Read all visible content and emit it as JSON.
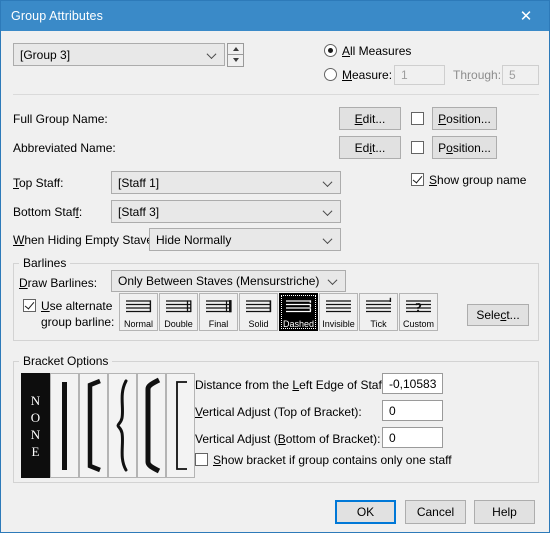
{
  "window": {
    "title": "Group Attributes",
    "close_icon": "close-icon",
    "titlebar_color": "#3a8ac8"
  },
  "top": {
    "group_selector_value": "[Group 3]",
    "spinner_up": "spin-up-icon",
    "spinner_down": "spin-down-icon",
    "all_measures_label": "All Measures",
    "all_measures_selected": true,
    "measure_label": "Measure:",
    "measure_value": "1",
    "through_label": "Through:",
    "through_value": "5"
  },
  "names": {
    "full_group_name_label": "Full Group Name:",
    "abbreviated_name_label": "Abbreviated Name:",
    "edit_label": "Edit...",
    "position_label": "Position...",
    "show_group_name_label": "Show group name",
    "show_group_name_checked": true
  },
  "staves": {
    "top_staff_label": "Top Staff:",
    "top_staff_value": "[Staff 1]",
    "bottom_staff_label": "Bottom Staff:",
    "bottom_staff_value": "[Staff 3]",
    "hiding_label": "When Hiding Empty Staves:",
    "hiding_value": "Hide Normally"
  },
  "barlines": {
    "group_label": "Barlines",
    "draw_barlines_label": "Draw Barlines:",
    "draw_barlines_value": "Only Between Staves (Mensurstriche)",
    "use_alternate_label_line1": "Use alternate",
    "use_alternate_label_line2": "group barline:",
    "use_alternate_checked": true,
    "select_label": "Select...",
    "styles": [
      {
        "label": "Normal",
        "selected": false
      },
      {
        "label": "Double",
        "selected": false
      },
      {
        "label": "Final",
        "selected": false
      },
      {
        "label": "Solid",
        "selected": false
      },
      {
        "label": "Dashed",
        "selected": true
      },
      {
        "label": "Invisible",
        "selected": false
      },
      {
        "label": "Tick",
        "selected": false
      },
      {
        "label": "Custom",
        "selected": false
      }
    ]
  },
  "bracket": {
    "group_label": "Bracket Options",
    "none_text": "NONE",
    "options": [
      {
        "name": "bracket-none",
        "selected": true
      },
      {
        "name": "bracket-thick-line",
        "selected": false
      },
      {
        "name": "bracket-square",
        "selected": false
      },
      {
        "name": "bracket-curly-brace",
        "selected": false
      },
      {
        "name": "bracket-piano-brace",
        "selected": false
      },
      {
        "name": "bracket-thin-square",
        "selected": false
      }
    ],
    "distance_label": "Distance from the Left Edge of Staff:",
    "distance_value": "-0,10583",
    "vtop_label": "Vertical Adjust (Top of Bracket):",
    "vtop_value": "0",
    "vbottom_label": "Vertical Adjust (Bottom of Bracket):",
    "vbottom_value": "0",
    "show_one_staff_label": "Show bracket if group contains only one staff",
    "show_one_staff_checked": false
  },
  "footer": {
    "ok_label": "OK",
    "cancel_label": "Cancel",
    "help_label": "Help"
  }
}
